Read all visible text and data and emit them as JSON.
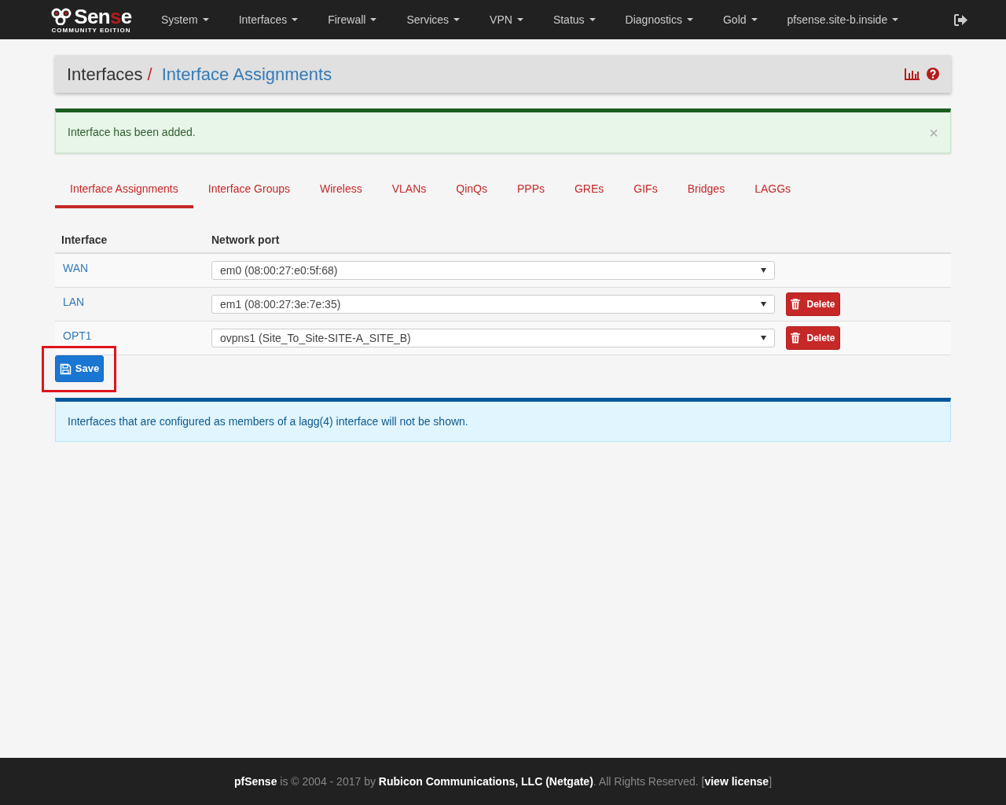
{
  "navbar": {
    "logo": {
      "before": "Sen",
      "accent": "s",
      "after": "e",
      "subtitle": "COMMUNITY EDITION"
    },
    "menus": [
      {
        "label": "System"
      },
      {
        "label": "Interfaces"
      },
      {
        "label": "Firewall"
      },
      {
        "label": "Services"
      },
      {
        "label": "VPN"
      },
      {
        "label": "Status"
      },
      {
        "label": "Diagnostics"
      },
      {
        "label": "Gold"
      },
      {
        "label": "pfsense.site-b.inside"
      }
    ]
  },
  "breadcrumb": {
    "parent": "Interfaces",
    "separator": "/",
    "current": "Interface Assignments"
  },
  "alert_success": {
    "message": "Interface has been added.",
    "close": "×"
  },
  "tabs": [
    {
      "label": "Interface Assignments",
      "selected": true
    },
    {
      "label": "Interface Groups",
      "selected": false
    },
    {
      "label": "Wireless",
      "selected": false
    },
    {
      "label": "VLANs",
      "selected": false
    },
    {
      "label": "QinQs",
      "selected": false
    },
    {
      "label": "PPPs",
      "selected": false
    },
    {
      "label": "GREs",
      "selected": false
    },
    {
      "label": "GIFs",
      "selected": false
    },
    {
      "label": "Bridges",
      "selected": false
    },
    {
      "label": "LAGGs",
      "selected": false
    }
  ],
  "table": {
    "columns": [
      "Interface",
      "Network port"
    ],
    "rows": [
      {
        "interface": "WAN",
        "port": "em0 (08:00:27:e0:5f:68)",
        "delete": null
      },
      {
        "interface": "LAN",
        "port": "em1 (08:00:27:3e:7e:35)",
        "delete": "Delete"
      },
      {
        "interface": "OPT1",
        "port": "ovpns1 (Site_To_Site-SITE-A_SITE_B)",
        "delete": "Delete"
      }
    ]
  },
  "save_button": {
    "label": "Save",
    "highlighted": true
  },
  "alert_info": {
    "message": "Interfaces that are configured as members of a lagg(4) interface will not be shown."
  },
  "footer": {
    "text": "**pfSense** is © 2004 - 2017 by **Rubicon Communications, LLC (Netgate)**. All Rights Reserved. [",
    "link": "view license",
    "after": "]"
  }
}
